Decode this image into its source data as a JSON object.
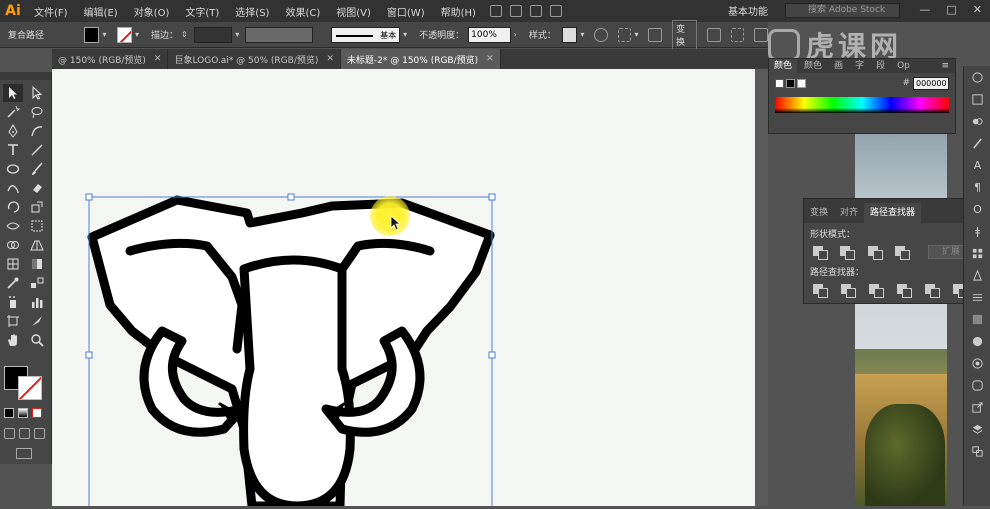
{
  "menubar": {
    "app_logo": "Ai",
    "items": [
      "文件(F)",
      "编辑(E)",
      "对象(O)",
      "文字(T)",
      "选择(S)",
      "效果(C)",
      "视图(V)",
      "窗口(W)",
      "帮助(H)"
    ],
    "workspace": "基本功能",
    "stock_search_placeholder": "搜索 Adobe Stock"
  },
  "controlbar": {
    "object_type": "复合路径",
    "stroke_label": "描边：",
    "stroke_profile": "基本",
    "opacity_label": "不透明度：",
    "opacity_value": "100%",
    "style_label": "样式：",
    "transform_button": "变换"
  },
  "tabs": [
    {
      "label": "@ 150% (RGB/预览)",
      "active": false
    },
    {
      "label": "巨象LOGO.ai* @ 50% (RGB/预览)",
      "active": false
    },
    {
      "label": "未标题-2* @ 150% (RGB/预览)",
      "active": true
    }
  ],
  "color_panel": {
    "tabs": [
      "颜色",
      "颜色",
      "画",
      "字",
      "段",
      "Op"
    ],
    "hex_value": "000000"
  },
  "pathfinder_panel": {
    "tabs": [
      "变换",
      "对齐",
      "路径查找器"
    ],
    "shape_modes_label": "形状模式：",
    "pathfinders_label": "路径查找器：",
    "expand_button": "扩展"
  },
  "watermark": "虎课网",
  "colors": {
    "accent": "#ff9a00",
    "highlight": "#fff028",
    "canvas": "#f4f6f4",
    "selection": "#4a7fd4"
  }
}
